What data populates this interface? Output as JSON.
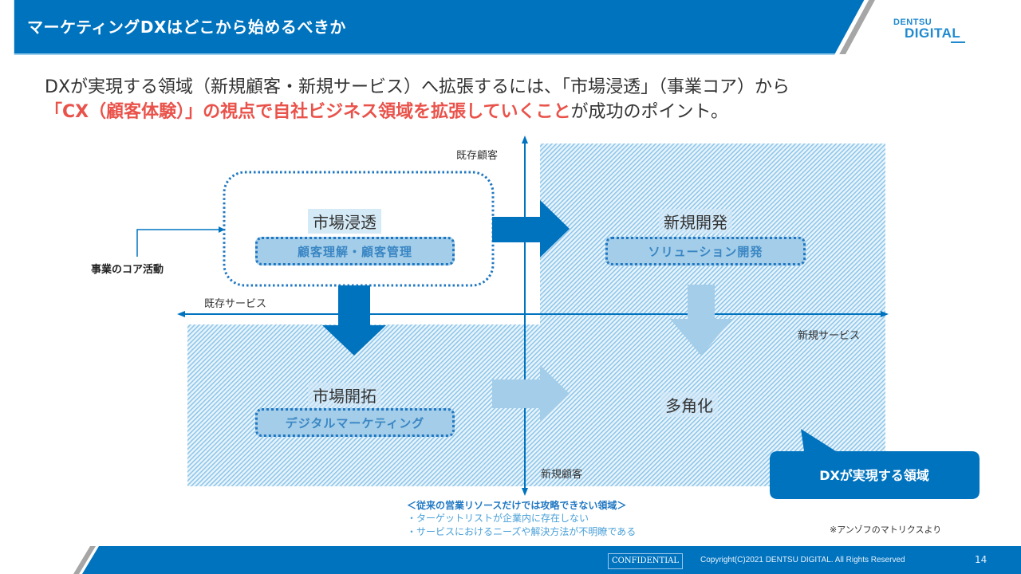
{
  "header": {
    "title": "マーケティングDXはどこから始めるべきか",
    "logo_line1": "DENTSU",
    "logo_line2": "DIGITAL"
  },
  "lead": {
    "line1": "DXが実現する領域（新規顧客・新規サービス）へ拡張するには、「市場浸透」（事業コア）から",
    "line2_highlight": "「CX（顧客体験）」の視点で自社ビジネス領域を拡張していくこと",
    "line2_rest": "が成功のポイント。"
  },
  "diagram": {
    "axis_labels": {
      "top": "既存顧客",
      "bottom": "新規顧客",
      "left": "既存サービス",
      "right": "新規サービス"
    },
    "core_activity_label": "事業のコア活動",
    "quadrants": [
      {
        "id": "market-penetration",
        "title": "市場浸透",
        "pill": "顧客理解・顧客管理"
      },
      {
        "id": "new-development",
        "title": "新規開発",
        "pill": "ソリューション開発"
      },
      {
        "id": "market-development",
        "title": "市場開拓",
        "pill": "デジタルマーケティング"
      },
      {
        "id": "diversification",
        "title": "多角化",
        "pill": ""
      }
    ],
    "callout": "DXが実現する領域"
  },
  "notes": {
    "title": "＜従来の営業リソースだけでは攻略できない領域＞",
    "items": [
      "・ターゲットリストが企業内に存在しない",
      "・サービスにおけるニーズや解決方法が不明瞭である"
    ],
    "source": "※アンゾフのマトリクスより"
  },
  "footer": {
    "confidential": "CONFIDENTIAL",
    "copyright": "Copyright(C)2021 DENTSU DIGITAL. All Rights Reserved",
    "page": "14"
  },
  "colors": {
    "brand_blue": "#0073bf",
    "light_blue": "#a3cde8",
    "highlight_red": "#e9524a"
  }
}
